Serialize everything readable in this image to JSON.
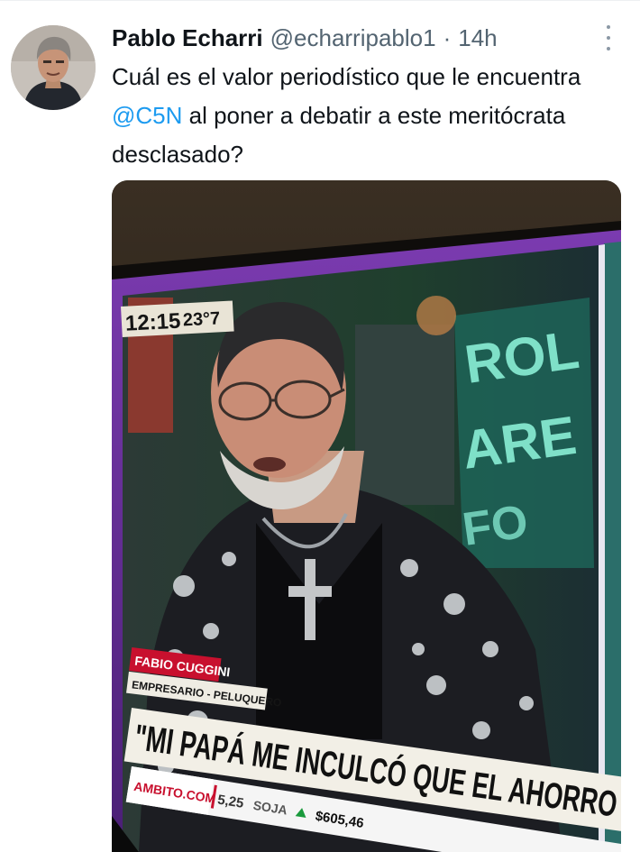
{
  "tweet": {
    "author_name": "Pablo Echarri",
    "handle": "@echarripablo1",
    "separator": "·",
    "time": "14h",
    "text_before": "Cuál es el valor periodístico que le encuentra ",
    "mention": "@C5N",
    "text_after": " al poner a debatir a este meritócrata desclasado?"
  },
  "media": {
    "clock": "12:15",
    "temperature": "23°7",
    "guest_name": "FABIO CUGGINI",
    "guest_role": "EMPRESARIO - PELUQUERO",
    "headline": "\"MI PAPÁ ME INCULCÓ QUE EL AHORRO",
    "ticker_source": "AMBITO.COM",
    "ticker_value": "5,25",
    "ticker_label": "SOJA",
    "ticker_price": "$605,46"
  },
  "colors": {
    "mention": "#1d9bf0",
    "secondary_text": "#536471",
    "tv_frame_purple": "#6a2f9c",
    "lower_third_red": "#c8102e"
  },
  "icons": [
    "more-options-icon",
    "ticker-up-arrow-icon"
  ]
}
